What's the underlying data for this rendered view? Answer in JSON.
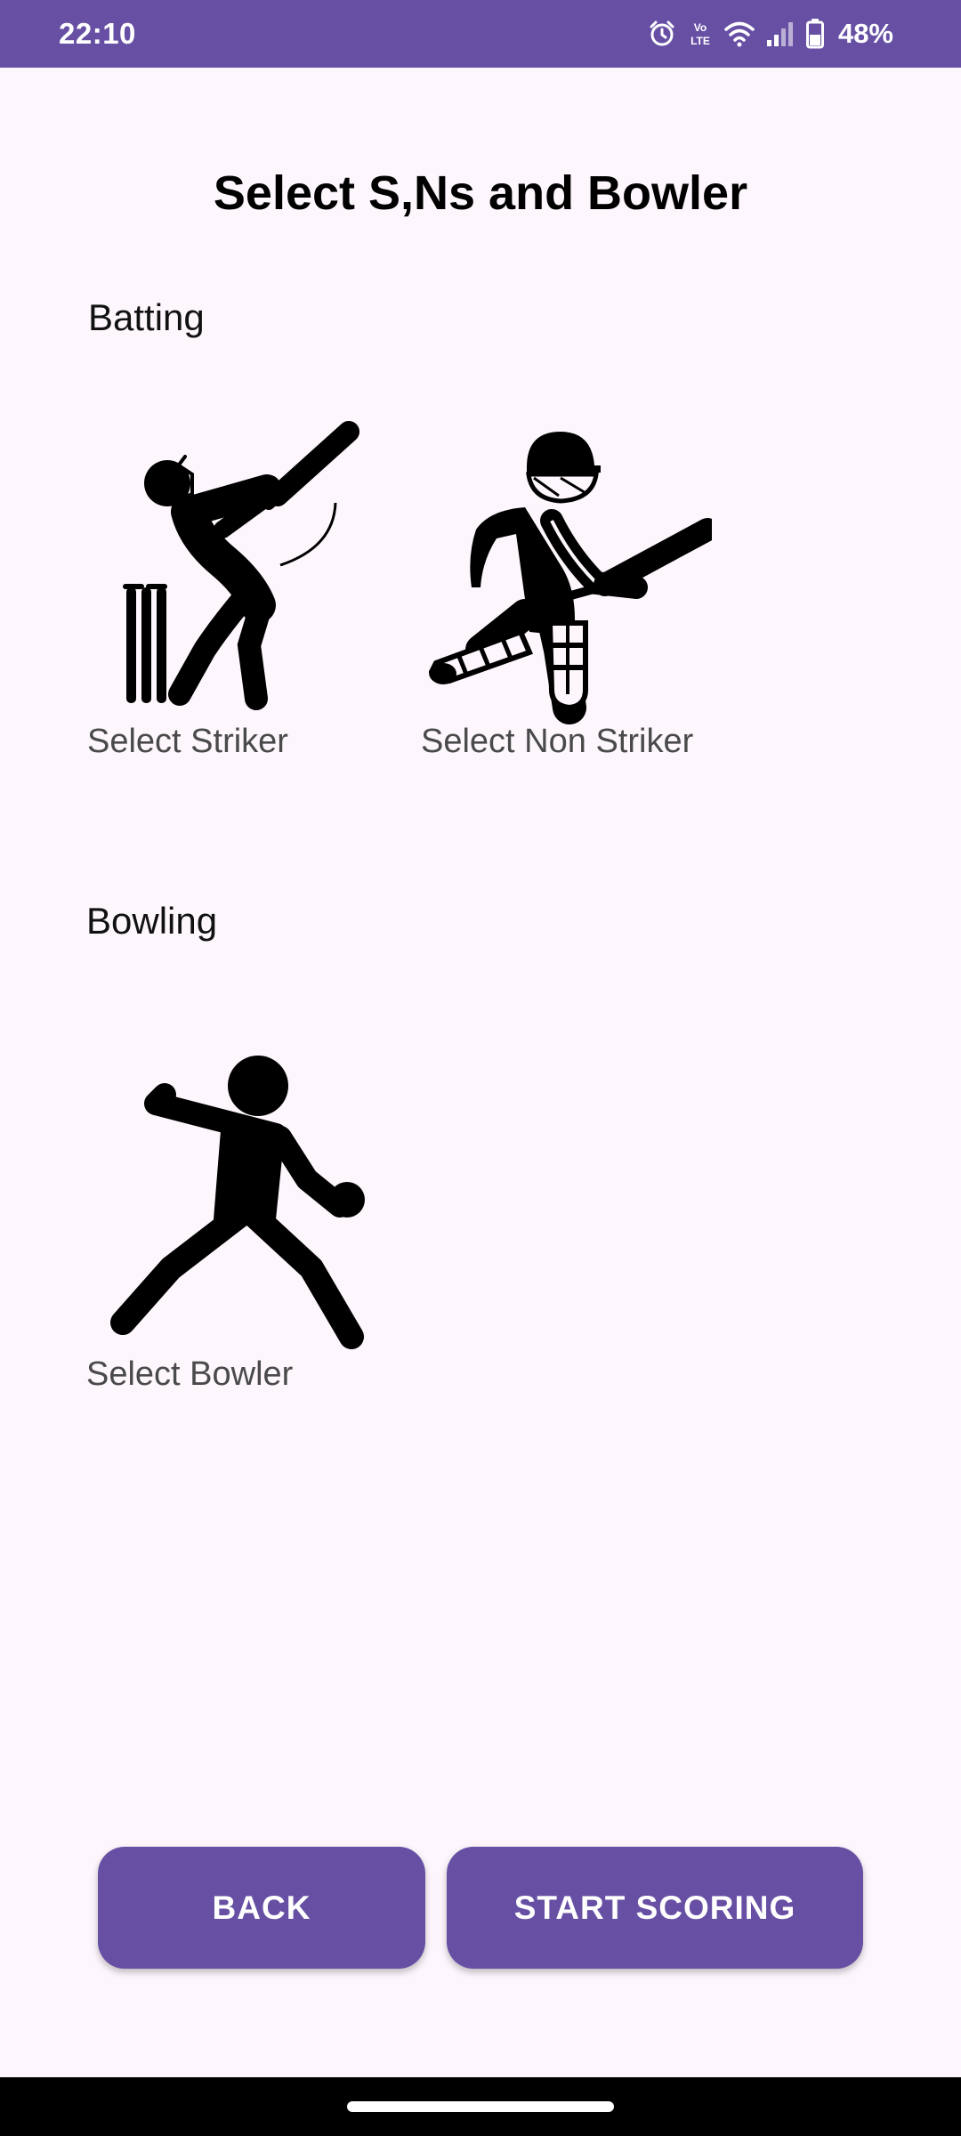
{
  "status_bar": {
    "time": "22:10",
    "battery": "48%",
    "icons": [
      "alarm-icon",
      "volte-icon",
      "wifi-icon",
      "signal-icon",
      "battery-icon"
    ],
    "background": "#6750a4"
  },
  "title": "Select S,Ns and Bowler",
  "batting": {
    "label": "Batting",
    "striker_label": "Select Striker",
    "non_striker_label": "Select Non Striker"
  },
  "bowling": {
    "label": "Bowling",
    "bowler_label": "Select Bowler"
  },
  "buttons": {
    "back": "BACK",
    "start_scoring": "START SCORING"
  },
  "colors": {
    "accent": "#6750a4",
    "background": "#fdf7fd"
  }
}
